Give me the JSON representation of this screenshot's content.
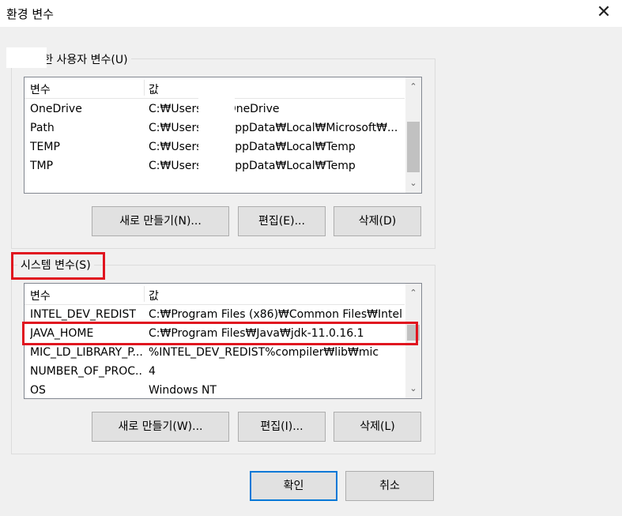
{
  "window": {
    "title": "환경 변수",
    "close_icon": "close-icon"
  },
  "user_vars": {
    "title": "에 대한 사용자 변수(U)",
    "columns": [
      "변수",
      "값"
    ],
    "rows": [
      {
        "name": "OneDrive",
        "value": "C:₩Users₩          ₩OneDrive"
      },
      {
        "name": "Path",
        "value": "C:₩Users₩          ₩AppData₩Local₩Microsoft₩..."
      },
      {
        "name": "TEMP",
        "value": "C:₩Users₩          ₩AppData₩Local₩Temp"
      },
      {
        "name": "TMP",
        "value": "C:₩Users₩          ₩AppData₩Local₩Temp"
      }
    ],
    "buttons": {
      "new": "새로 만들기(N)...",
      "edit": "편집(E)...",
      "delete": "삭제(D)"
    }
  },
  "system_vars": {
    "title": "시스템 변수(S)",
    "columns": [
      "변수",
      "값"
    ],
    "rows": [
      {
        "name": "INTEL_DEV_REDIST",
        "value": "C:₩Program Files (x86)₩Common Files₩Intel..."
      },
      {
        "name": "JAVA_HOME",
        "value": "C:₩Program Files₩Java₩jdk-11.0.16.1"
      },
      {
        "name": "MIC_LD_LIBRARY_P...",
        "value": "%INTEL_DEV_REDIST%compiler₩lib₩mic"
      },
      {
        "name": "NUMBER_OF_PROC...",
        "value": "4"
      },
      {
        "name": "OS",
        "value": "Windows NT"
      }
    ],
    "buttons": {
      "new": "새로 만들기(W)...",
      "edit": "편집(I)...",
      "delete": "삭제(L)"
    }
  },
  "footer": {
    "ok": "확인",
    "cancel": "취소"
  },
  "colors": {
    "highlight": "#e0141f",
    "accent": "#0078d7"
  }
}
